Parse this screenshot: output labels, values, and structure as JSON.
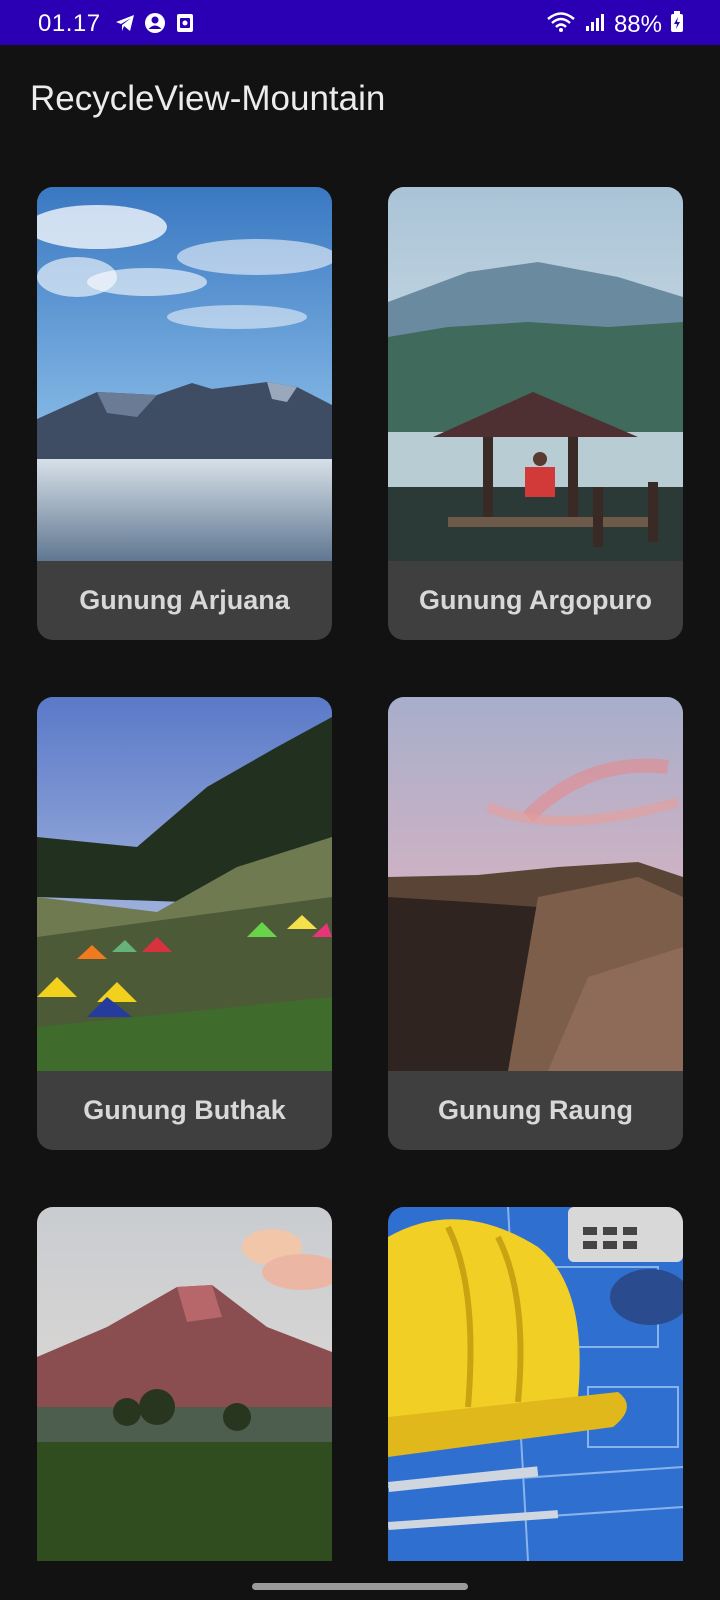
{
  "status_bar": {
    "time": "01.17",
    "battery": "88%",
    "left_icons": [
      "telegram-icon",
      "account-icon",
      "screenshot-icon"
    ],
    "right_icons": [
      "wifi-icon",
      "signal-icon",
      "battery-icon"
    ],
    "background_color": "#2b00b5"
  },
  "app_bar": {
    "title": "RecycleView-Mountain"
  },
  "mountains": [
    {
      "name": "Gunung Arjuana",
      "image": "misty-mountain-under-blue-sky"
    },
    {
      "name": "Gunung Argopuro",
      "image": "person-on-wooden-gazebo-by-lake"
    },
    {
      "name": "Gunung Buthak",
      "image": "tents-on-grassy-hillside"
    },
    {
      "name": "Gunung Raung",
      "image": "volcanic-crater-at-dusk"
    },
    {
      "name": "",
      "image": "volcano-cone-above-rice-field"
    },
    {
      "name": "",
      "image": "yellow-hard-hat-on-blueprints"
    }
  ],
  "colors": {
    "background": "#121212",
    "card": "#3f3f3f",
    "card_text": "#d8d8d8"
  }
}
